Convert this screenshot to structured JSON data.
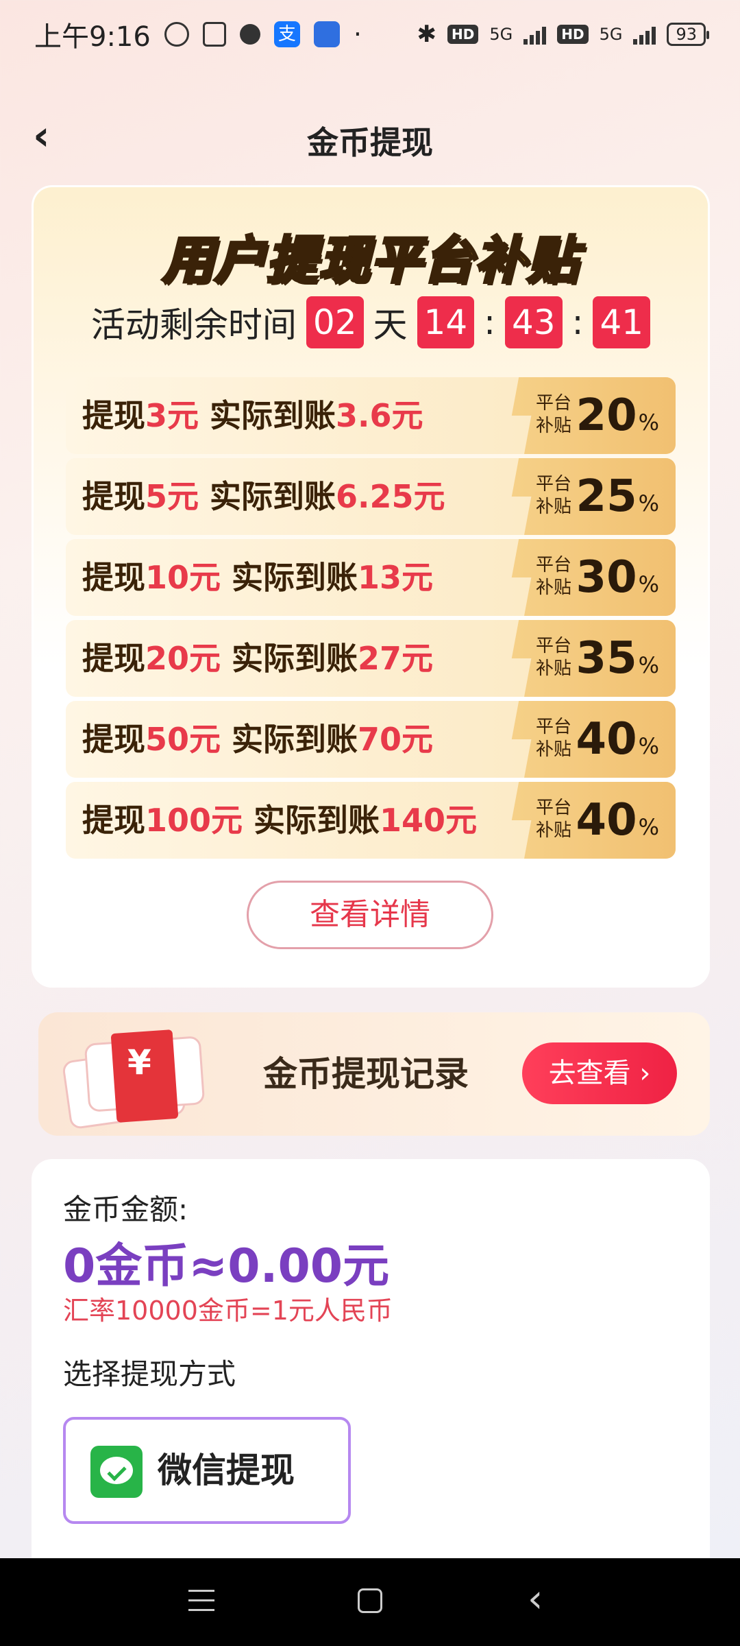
{
  "status_bar": {
    "time": "上午9:16",
    "network_hd_1": "HD",
    "network_5g_1": "5G",
    "network_hd_2": "HD",
    "network_5g_2": "5G",
    "battery": "93",
    "alipay_glyph": "支"
  },
  "header": {
    "title": "金币提现",
    "back_icon": "‹"
  },
  "promo": {
    "banner_part1": "用户提现",
    "banner_part2": "平台补贴",
    "countdown_label": "活动剩余时间",
    "days": "02",
    "days_unit": "天",
    "hours": "14",
    "minutes": "43",
    "seconds": "41",
    "sep": ":",
    "tiers": [
      {
        "pre": "提现",
        "amount": "3元",
        "mid": " 实际到账",
        "receive": "3.6元",
        "badge_l1": "平台",
        "badge_l2": "补贴",
        "pct": "20",
        "pct_sign": "%"
      },
      {
        "pre": "提现",
        "amount": "5元",
        "mid": " 实际到账",
        "receive": "6.25元",
        "badge_l1": "平台",
        "badge_l2": "补贴",
        "pct": "25",
        "pct_sign": "%"
      },
      {
        "pre": "提现",
        "amount": "10元",
        "mid": " 实际到账",
        "receive": "13元",
        "badge_l1": "平台",
        "badge_l2": "补贴",
        "pct": "30",
        "pct_sign": "%"
      },
      {
        "pre": "提现",
        "amount": "20元",
        "mid": " 实际到账",
        "receive": "27元",
        "badge_l1": "平台",
        "badge_l2": "补贴",
        "pct": "35",
        "pct_sign": "%"
      },
      {
        "pre": "提现",
        "amount": "50元",
        "mid": " 实际到账",
        "receive": "70元",
        "badge_l1": "平台",
        "badge_l2": "补贴",
        "pct": "40",
        "pct_sign": "%"
      },
      {
        "pre": "提现",
        "amount": "100元",
        "mid": " 实际到账",
        "receive": "140元",
        "badge_l1": "平台",
        "badge_l2": "补贴",
        "pct": "40",
        "pct_sign": "%"
      }
    ],
    "detail_button": "查看详情"
  },
  "records": {
    "title": "金币提现记录",
    "button": "去查看 ›",
    "yen_glyph": "¥"
  },
  "balance": {
    "label": "金币金额:",
    "value": "0金币≈0.00元",
    "rate": "汇率10000金币=1元人民币",
    "method_label": "选择提现方式",
    "wechat_option": "微信提现"
  },
  "system_nav": {
    "back_glyph": "‹"
  },
  "colors": {
    "accent_red": "#ee2d4b",
    "balance_purple": "#7a3fc0",
    "wechat_green": "#28b448",
    "selected_border": "#b688f0"
  }
}
